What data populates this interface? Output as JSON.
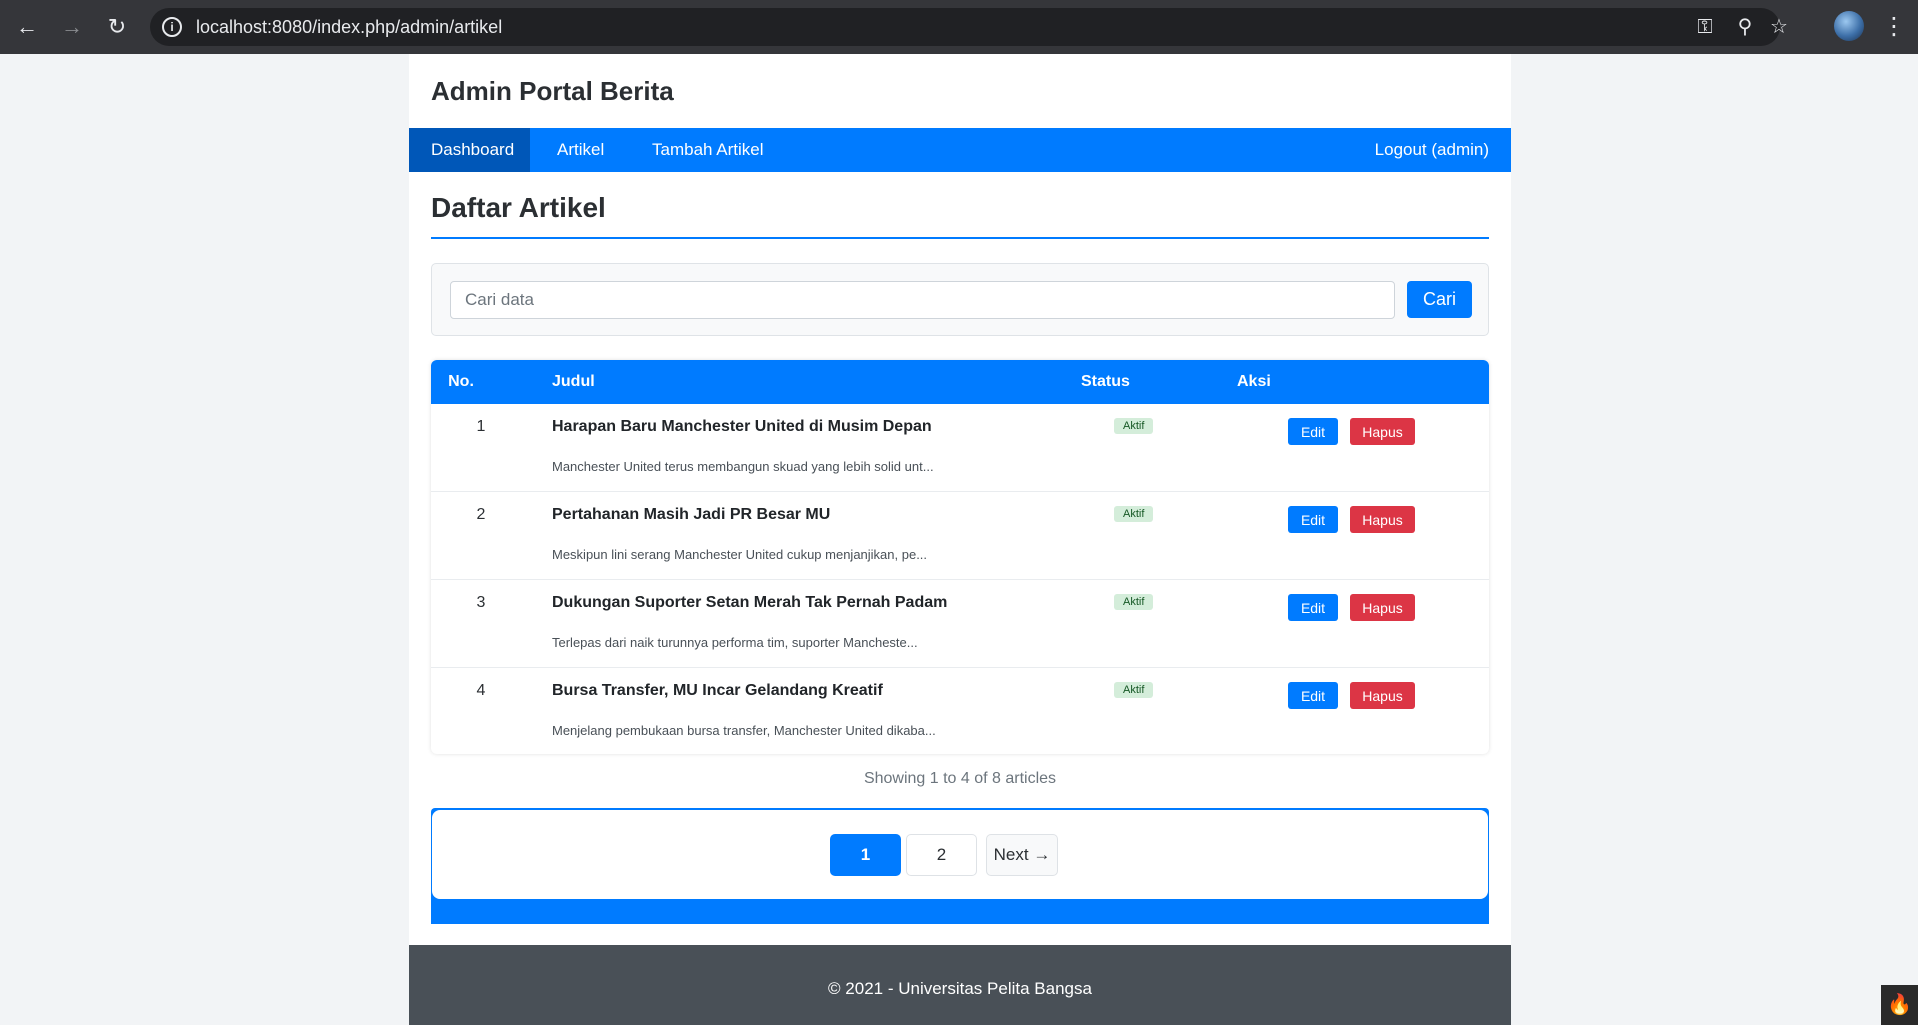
{
  "browser": {
    "url": "localhost:8080/index.php/admin/artikel",
    "back_icon": "←",
    "forward_icon": "→",
    "reload_icon": "↻",
    "info_icon": "i",
    "key_icon": "⚿",
    "zoom_icon": "⚲",
    "star_icon": "☆",
    "menu_icon": "⋮"
  },
  "site": {
    "title": "Admin Portal Berita"
  },
  "nav": {
    "items": [
      {
        "label": "Dashboard",
        "active": true
      },
      {
        "label": "Artikel"
      },
      {
        "label": "Tambah Artikel"
      }
    ],
    "logout": "Logout (admin)"
  },
  "page": {
    "heading": "Daftar Artikel"
  },
  "search": {
    "placeholder": "Cari data",
    "value": "",
    "button": "Cari"
  },
  "table": {
    "headers": [
      "No.",
      "Judul",
      "Status",
      "Aksi"
    ],
    "rows": [
      {
        "no": "1",
        "title": "Harapan Baru Manchester United di Musim Depan",
        "excerpt": "Manchester United terus membangun skuad yang lebih solid unt...",
        "status": "Aktif",
        "edit": "Edit",
        "delete": "Hapus"
      },
      {
        "no": "2",
        "title": "Pertahanan Masih Jadi PR Besar MU",
        "excerpt": "Meskipun lini serang Manchester United cukup menjanjikan, pe...",
        "status": "Aktif",
        "edit": "Edit",
        "delete": "Hapus"
      },
      {
        "no": "3",
        "title": "Dukungan Suporter Setan Merah Tak Pernah Padam",
        "excerpt": "Terlepas dari naik turunnya performa tim, suporter Mancheste...",
        "status": "Aktif",
        "edit": "Edit",
        "delete": "Hapus"
      },
      {
        "no": "4",
        "title": "Bursa Transfer, MU Incar Gelandang Kreatif",
        "excerpt": "Menjelang pembukaan bursa transfer, Manchester United dikaba...",
        "status": "Aktif",
        "edit": "Edit",
        "delete": "Hapus"
      }
    ]
  },
  "summary": "Showing 1 to 4 of 8 articles",
  "pagination": {
    "pages": [
      "1",
      "2"
    ],
    "current": "1",
    "next": "Next →"
  },
  "footer": {
    "text": "© 2021 - Universitas Pelita Bangsa"
  },
  "colors": {
    "primary": "#007bff",
    "danger": "#dc3545",
    "success_bg": "#d4edda",
    "footer": "#495057"
  }
}
